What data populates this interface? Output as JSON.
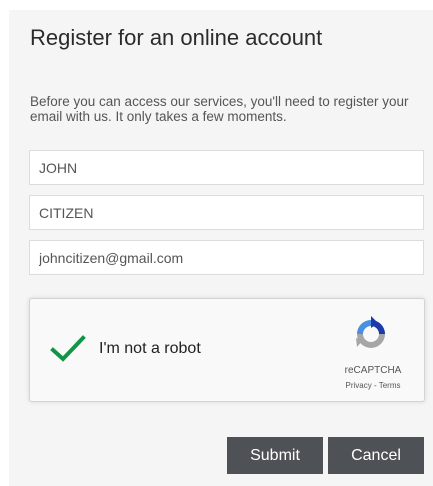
{
  "form": {
    "title": "Register for an online account",
    "intro": "Before you can access our services, you'll need to register your email with us. It only takes a few moments.",
    "fields": [
      {
        "value": "JOHN"
      },
      {
        "value": "CITIZEN"
      },
      {
        "value": "johncitizen@gmail.com"
      }
    ]
  },
  "captcha": {
    "label": "I'm not a robot",
    "brand": "reCAPTCHA",
    "privacy": "Privacy",
    "separator": " - ",
    "terms": "Terms",
    "checked": true
  },
  "actions": {
    "submit": "Submit",
    "cancel": "Cancel"
  },
  "colors": {
    "panel": "#f5f5f5",
    "button": "#4e5155",
    "check": "#109547"
  },
  "icons": {
    "checkmark": "checkmark-icon",
    "recaptcha": "recaptcha-logo-icon"
  }
}
